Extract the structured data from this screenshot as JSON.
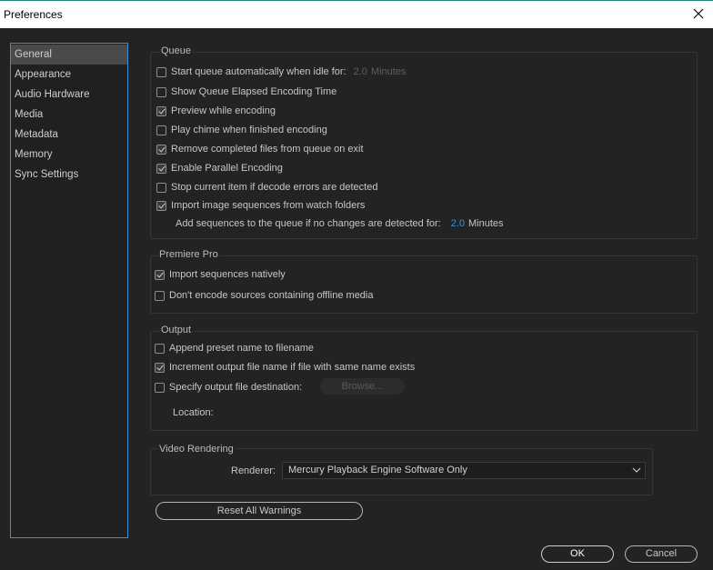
{
  "window": {
    "title": "Preferences"
  },
  "sidebar": {
    "items": [
      {
        "label": "General",
        "active": true
      },
      {
        "label": "Appearance"
      },
      {
        "label": "Audio Hardware"
      },
      {
        "label": "Media"
      },
      {
        "label": "Metadata"
      },
      {
        "label": "Memory"
      },
      {
        "label": "Sync Settings"
      }
    ]
  },
  "queue": {
    "legend": "Queue",
    "options": [
      {
        "label": "Start queue automatically when idle for:",
        "checked": false
      },
      {
        "label": "Show Queue Elapsed Encoding Time",
        "checked": false
      },
      {
        "label": "Preview while encoding",
        "checked": true
      },
      {
        "label": "Play chime when finished encoding",
        "checked": false
      },
      {
        "label": "Remove completed files from queue on exit",
        "checked": true
      },
      {
        "label": "Enable Parallel Encoding",
        "checked": true
      },
      {
        "label": "Stop current item if decode errors are detected",
        "checked": false
      },
      {
        "label": "Import image sequences from watch folders",
        "checked": true
      }
    ],
    "idle_value": "2.0",
    "idle_unit": "Minutes",
    "add_sequences_label": "Add sequences to the queue if no changes are detected for:",
    "add_sequences_value": "2.0",
    "add_sequences_unit": "Minutes"
  },
  "premiere": {
    "legend": "Premiere Pro",
    "options": [
      {
        "label": "Import sequences natively",
        "checked": true
      },
      {
        "label": "Don't encode sources containing offline media",
        "checked": false
      }
    ]
  },
  "output": {
    "legend": "Output",
    "options": [
      {
        "label": "Append preset name to filename",
        "checked": false
      },
      {
        "label": "Increment output file name if file with same name exists",
        "checked": true
      },
      {
        "label": "Specify output file destination:",
        "checked": false
      }
    ],
    "browse_label": "Browse...",
    "location_label": "Location:"
  },
  "video_rendering": {
    "legend": "Video Rendering",
    "renderer_label": "Renderer:",
    "renderer_value": "Mercury Playback Engine Software Only"
  },
  "buttons": {
    "reset_warnings": "Reset All Warnings",
    "ok": "OK",
    "cancel": "Cancel"
  },
  "colors": {
    "background": "#232323",
    "accent_blue": "#3e8fdb",
    "sidebar_border": "#3c8fd0"
  }
}
